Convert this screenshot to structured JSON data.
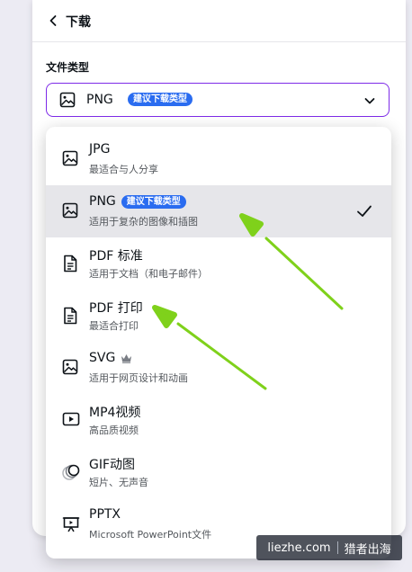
{
  "panel": {
    "title": "下载",
    "section_label": "文件类型",
    "select": {
      "value": "PNG",
      "badge": "建议下载类型",
      "icon": "image-icon"
    }
  },
  "options": [
    {
      "label": "JPG",
      "sub": "最适合与人分享",
      "icon": "image-icon",
      "selected": false
    },
    {
      "label": "PNG",
      "badge": "建议下载类型",
      "sub": "适用于复杂的图像和插图",
      "icon": "image-icon",
      "selected": true
    },
    {
      "label": "PDF 标准",
      "sub": "适用于文档（和电子邮件）",
      "icon": "document-icon",
      "selected": false
    },
    {
      "label": "PDF 打印",
      "sub": "最适合打印",
      "icon": "document-icon",
      "selected": false
    },
    {
      "label": "SVG",
      "sub": "适用于网页设计和动画",
      "icon": "image-icon",
      "premium": true,
      "selected": false
    },
    {
      "label": "MP4视频",
      "sub": "高品质视频",
      "icon": "video-icon",
      "selected": false
    },
    {
      "label": "GIF动图",
      "sub": "短片、无声音",
      "icon": "gif-icon",
      "selected": false
    },
    {
      "label": "PPTX",
      "sub": "Microsoft PowerPoint文件",
      "icon": "presentation-icon",
      "selected": false
    }
  ],
  "watermark": {
    "site": "liezhe.com",
    "name": "猎者出海"
  },
  "colors": {
    "accent": "#7d2ae8",
    "badge": "#2a6cf0",
    "selected_bg": "#e6e6ea",
    "annotation_arrow": "#7fd11b"
  }
}
